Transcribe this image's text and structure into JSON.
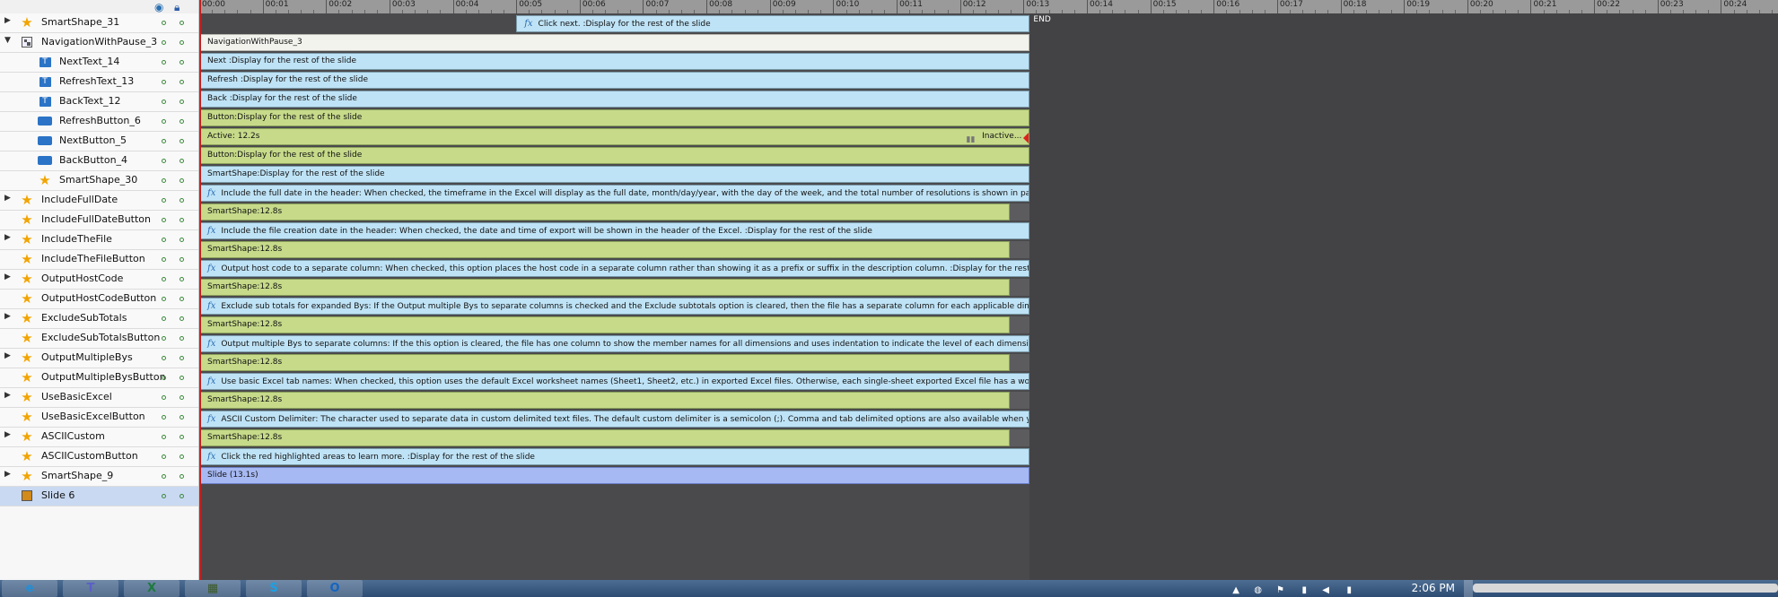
{
  "layers_header": {
    "visibility_icon": "eye-icon",
    "lock_icon": "lock-icon"
  },
  "layers": [
    {
      "name": "SmartShape_31",
      "icon": "star",
      "expander": "▶",
      "indent": 0
    },
    {
      "name": "NavigationWithPause_3",
      "icon": "group",
      "expander": "▼",
      "indent": 0
    },
    {
      "name": "NextText_14",
      "icon": "text",
      "expander": "",
      "indent": 1
    },
    {
      "name": "RefreshText_13",
      "icon": "text",
      "expander": "",
      "indent": 1
    },
    {
      "name": "BackText_12",
      "icon": "text",
      "expander": "",
      "indent": 1
    },
    {
      "name": "RefreshButton_6",
      "icon": "button",
      "expander": "",
      "indent": 1
    },
    {
      "name": "NextButton_5",
      "icon": "button",
      "expander": "",
      "indent": 1
    },
    {
      "name": "BackButton_4",
      "icon": "button",
      "expander": "",
      "indent": 1
    },
    {
      "name": "SmartShape_30",
      "icon": "star",
      "expander": "",
      "indent": 1
    },
    {
      "name": "IncludeFullDate",
      "icon": "star",
      "expander": "▶",
      "indent": 0
    },
    {
      "name": "IncludeFullDateButton",
      "icon": "star",
      "expander": "",
      "indent": 0
    },
    {
      "name": "IncludeTheFile",
      "icon": "star",
      "expander": "▶",
      "indent": 0
    },
    {
      "name": "IncludeTheFileButton",
      "icon": "star",
      "expander": "",
      "indent": 0
    },
    {
      "name": "OutputHostCode",
      "icon": "star",
      "expander": "▶",
      "indent": 0
    },
    {
      "name": "OutputHostCodeButton",
      "icon": "star",
      "expander": "",
      "indent": 0
    },
    {
      "name": "ExcludeSubTotals",
      "icon": "star",
      "expander": "▶",
      "indent": 0
    },
    {
      "name": "ExcludeSubTotalsButton",
      "icon": "star",
      "expander": "",
      "indent": 0
    },
    {
      "name": "OutputMultipleBys",
      "icon": "star",
      "expander": "▶",
      "indent": 0
    },
    {
      "name": "OutputMultipleBysButton",
      "icon": "star",
      "expander": "",
      "indent": 0
    },
    {
      "name": "UseBasicExcel",
      "icon": "star",
      "expander": "▶",
      "indent": 0
    },
    {
      "name": "UseBasicExcelButton",
      "icon": "star",
      "expander": "",
      "indent": 0
    },
    {
      "name": "ASCIICustom",
      "icon": "star",
      "expander": "▶",
      "indent": 0
    },
    {
      "name": "ASCIICustomButton",
      "icon": "star",
      "expander": "",
      "indent": 0
    },
    {
      "name": "SmartShape_9",
      "icon": "star",
      "expander": "▶",
      "indent": 0
    },
    {
      "name": "Slide 6",
      "icon": "slide",
      "expander": "",
      "indent": 0,
      "selected": true
    }
  ],
  "ruler_labels": [
    "00:00",
    "00:01",
    "00:02",
    "00:03",
    "00:04",
    "00:05",
    "00:06",
    "00:07",
    "00:08",
    "00:09",
    "00:10",
    "00:11",
    "00:12",
    "00:13",
    "00:14",
    "00:15",
    "00:16",
    "00:17",
    "00:18",
    "00:19",
    "00:20",
    "00:21",
    "00:22",
    "00:23",
    "00:24"
  ],
  "timeline": {
    "seconds_visible": 24.9,
    "slide_duration_s": 13.1,
    "end_label": "END",
    "bars": [
      {
        "style": "blue",
        "fx": true,
        "text": "Click next. :Display for the rest of the slide",
        "start_s": 5.0
      },
      {
        "style": "white",
        "fx": false,
        "text": "NavigationWithPause_3",
        "start_s": 0
      },
      {
        "style": "blue",
        "fx": false,
        "text": "Next :Display for the rest of the slide",
        "start_s": 0
      },
      {
        "style": "blue",
        "fx": false,
        "text": "Refresh :Display for the rest of the slide",
        "start_s": 0
      },
      {
        "style": "blue",
        "fx": false,
        "text": "Back :Display for the rest of the slide",
        "start_s": 0
      },
      {
        "style": "green",
        "fx": false,
        "text": "Button:Display for the rest of the slide",
        "start_s": 0
      },
      {
        "style": "green",
        "fx": false,
        "text": "Active: 12.2s",
        "start_s": 0,
        "inactive_label": "Inactive..."
      },
      {
        "style": "green",
        "fx": false,
        "text": "Button:Display for the rest of the slide",
        "start_s": 0
      },
      {
        "style": "blue",
        "fx": false,
        "text": "SmartShape:Display for the rest of the slide",
        "start_s": 0
      },
      {
        "style": "blue",
        "fx": true,
        "text": "Include the full date in the header: When checked, the timeframe in the Excel will display as the full date, month/day/year, with the day of the week, and the total number of resolutions is shown in parenthesis....",
        "start_s": 0
      },
      {
        "style": "green",
        "fx": false,
        "text": "SmartShape:12.8s",
        "start_s": 0,
        "short": true
      },
      {
        "style": "blue",
        "fx": true,
        "text": "Include the file creation date in the header:  When checked, the date and time of export will be shown in the header of the Excel.   :Display for the rest of the slide",
        "start_s": 0
      },
      {
        "style": "green",
        "fx": false,
        "text": "SmartShape:12.8s",
        "start_s": 0,
        "short": true
      },
      {
        "style": "blue",
        "fx": true,
        "text": "Output host code to a separate column: When checked, this option places the host code in a separate column rather than showing it as a prefix or suffix in the description column.   :Display for the rest of the slide",
        "start_s": 0
      },
      {
        "style": "green",
        "fx": false,
        "text": "SmartShape:12.8s",
        "start_s": 0,
        "short": true
      },
      {
        "style": "blue",
        "fx": true,
        "text": "Exclude sub totals for expanded Bys:  If the Output multiple Bys to separate columns is checked and the Exclude subtotals option is cleared, then the file has a separate column for each applicable dimension an...",
        "start_s": 0
      },
      {
        "style": "green",
        "fx": false,
        "text": "SmartShape:12.8s",
        "start_s": 0,
        "short": true
      },
      {
        "style": "blue",
        "fx": true,
        "text": "Output multiple Bys to separate columns:   If the this option is cleared, the file has one column to show the member names for all dimensions and uses indentation to indicate the level of each dimension mem...",
        "start_s": 0
      },
      {
        "style": "green",
        "fx": false,
        "text": "SmartShape:12.8s",
        "start_s": 0,
        "short": true
      },
      {
        "style": "blue",
        "fx": true,
        "text": "Use basic Excel tab names:   When checked, this option uses the default Excel worksheet names (Sheet1, Sheet2, etc.) in exported Excel files. Otherwise, each single-sheet exported Excel file has a worksheet n...",
        "start_s": 0
      },
      {
        "style": "green",
        "fx": false,
        "text": "SmartShape:12.8s",
        "start_s": 0,
        "short": true
      },
      {
        "style": "blue",
        "fx": true,
        "text": "ASCII Custom Delimiter:   The character used to separate data in custom delimited text files. The default custom delimiter is a semicolon (;). Comma and tab delimited options are also available when you export...",
        "start_s": 0
      },
      {
        "style": "green",
        "fx": false,
        "text": "SmartShape:12.8s",
        "start_s": 0,
        "short": true
      },
      {
        "style": "blue",
        "fx": true,
        "text": "Click the red highlighted areas to learn more. :Display for the rest of the slide",
        "start_s": 0
      },
      {
        "style": "slide",
        "fx": false,
        "text": "Slide (13.1s)",
        "start_s": 0
      }
    ]
  },
  "taskbar": {
    "apps": [
      {
        "name": "internet-explorer",
        "glyph": "e",
        "color": "#1f8fd8"
      },
      {
        "name": "teams",
        "glyph": "T",
        "color": "#5b5fc7"
      },
      {
        "name": "excel",
        "glyph": "X",
        "color": "#1d7a3e"
      },
      {
        "name": "captivate",
        "glyph": "▦",
        "color": "#3c5a2a"
      },
      {
        "name": "skype",
        "glyph": "S",
        "color": "#1aa1e6"
      },
      {
        "name": "outlook",
        "glyph": "O",
        "color": "#1565c0"
      }
    ],
    "clock": "2:06 PM"
  }
}
